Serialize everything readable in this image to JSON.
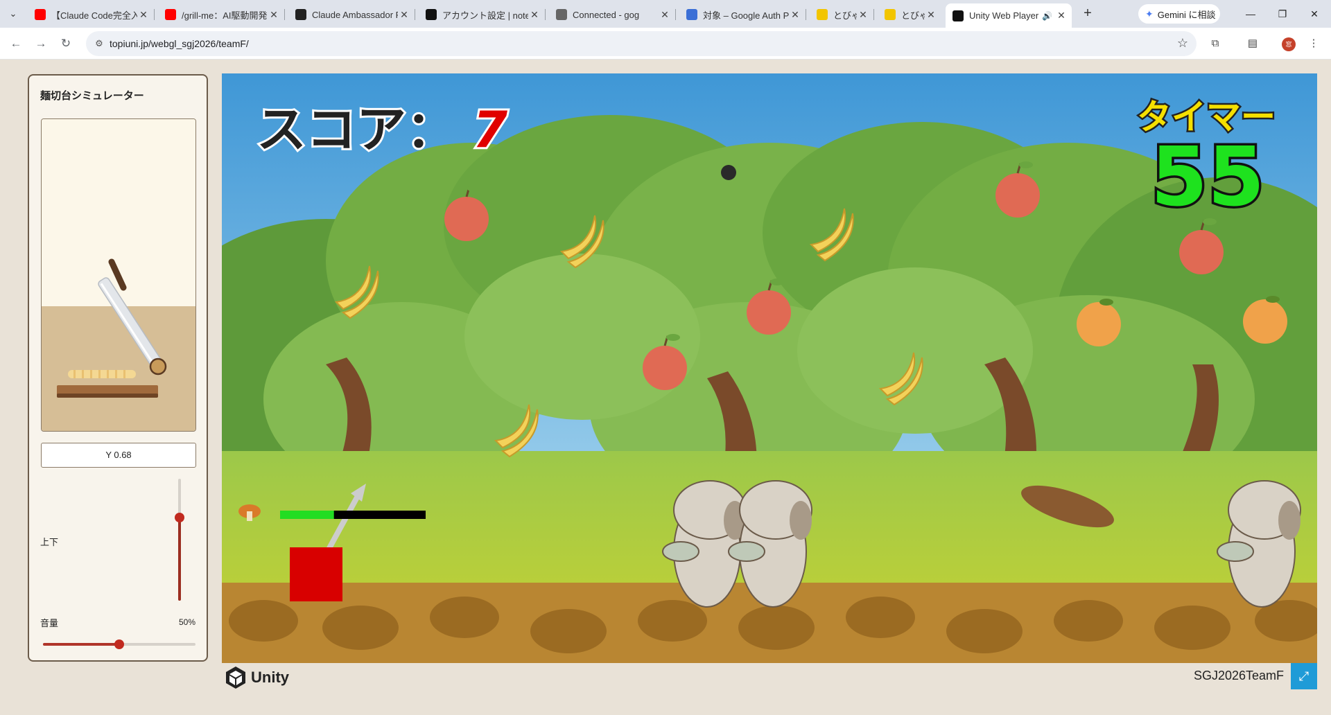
{
  "browser": {
    "tabs": [
      {
        "title": "【Claude Code完全入門",
        "favicon": "youtube-icon",
        "color": "#ff0000"
      },
      {
        "title": "/grill-me：AI駆動開発",
        "favicon": "youtube-icon",
        "color": "#ff0000"
      },
      {
        "title": "Claude Ambassador P",
        "favicon": "app-icon",
        "color": "#222222"
      },
      {
        "title": "アカウント設定 | note",
        "favicon": "note-icon",
        "color": "#111111"
      },
      {
        "title": "Connected - gog",
        "favicon": "globe-icon",
        "color": "#666666"
      },
      {
        "title": "対象 – Google Auth P",
        "favicon": "shield-icon",
        "color": "#3b6fd6"
      },
      {
        "title": "とびゃ",
        "favicon": "smiley-icon",
        "color": "#f2c500"
      },
      {
        "title": "とびゃ",
        "favicon": "smiley-icon",
        "color": "#f2c500"
      },
      {
        "title": "Unity Web Player",
        "favicon": "unity-icon",
        "color": "#111111",
        "audio": "speaker-icon"
      }
    ],
    "new_tab": "+",
    "gemini_label": "Gemini に相談",
    "url": "topiuni.jp/webgl_sgj2026/teamF/",
    "profile_initial": "窓"
  },
  "panel": {
    "title": "麺切台シミュレーター",
    "y_readout": "Y 0.68",
    "updown_label": "上下",
    "updown_level": 0.68,
    "volume_label": "音量",
    "volume_pct": "50%",
    "volume_level": 0.5
  },
  "game": {
    "score_label": "スコア：",
    "score_value": "7",
    "timer_label": "タイマー",
    "timer_value": "55",
    "power_level": 0.37
  },
  "footer": {
    "unity_word": "Unity",
    "team": "SGJ2026TeamF"
  }
}
